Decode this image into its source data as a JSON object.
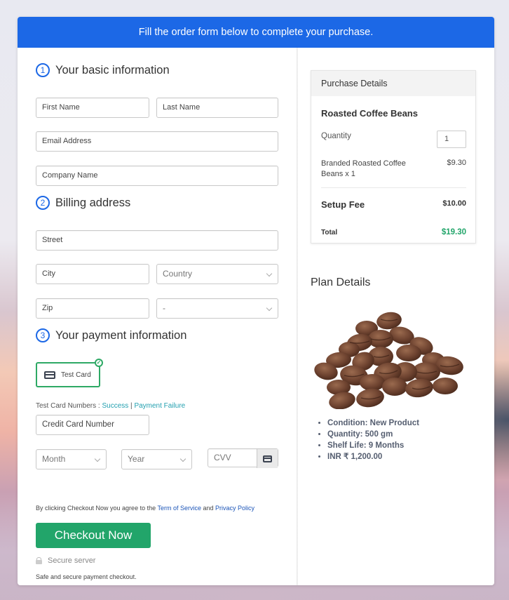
{
  "banner": {
    "text": "Fill the order form below to complete your purchase."
  },
  "sections": {
    "basic": {
      "num": "1",
      "title": "Your basic information"
    },
    "billing": {
      "num": "2",
      "title": "Billing address"
    },
    "payment": {
      "num": "3",
      "title": "Your payment information"
    }
  },
  "fields": {
    "first_name": "First Name",
    "last_name": "Last Name",
    "email": "Email Address",
    "company": "Company Name",
    "street": "Street",
    "city": "City",
    "country": "Country",
    "zip": "Zip",
    "state": "-",
    "card_number": "Credit Card Number",
    "month": "Month",
    "year": "Year",
    "cvv": "CVV"
  },
  "payment": {
    "method_label": "Test Card",
    "test_numbers_label": "Test Card Numbers : ",
    "success_link": "Success",
    "separator": " | ",
    "failure_link": "Payment Failure"
  },
  "agreement": {
    "prefix": "By clicking Checkout Now you agree to the ",
    "terms_link": "Term of Service",
    "and": " and ",
    "privacy_link": "Privacy Policy"
  },
  "checkout": {
    "button_label": "Checkout Now",
    "secure_label": "Secure server",
    "safe_text": "Safe and secure payment checkout."
  },
  "purchase": {
    "header": "Purchase Details",
    "product_name": "Roasted Coffee Beans",
    "quantity_label": "Quantity",
    "quantity_value": "1",
    "item_label": "Branded Roasted Coffee Beans x 1",
    "item_price": "$9.30",
    "setup_fee_label": "Setup Fee",
    "setup_fee_price": "$10.00",
    "total_label": "Total",
    "total_price": "$19.30"
  },
  "plan": {
    "title": "Plan Details",
    "details": [
      "Condition: New Product",
      "Quantity: 500 gm",
      "Shelf Life: 9 Months",
      "INR ₹ 1,200.00"
    ]
  },
  "colors": {
    "brand_blue": "#1c68e6",
    "success_green": "#22a56a",
    "link_teal": "#23a0b0",
    "link_blue": "#1c55b8"
  }
}
